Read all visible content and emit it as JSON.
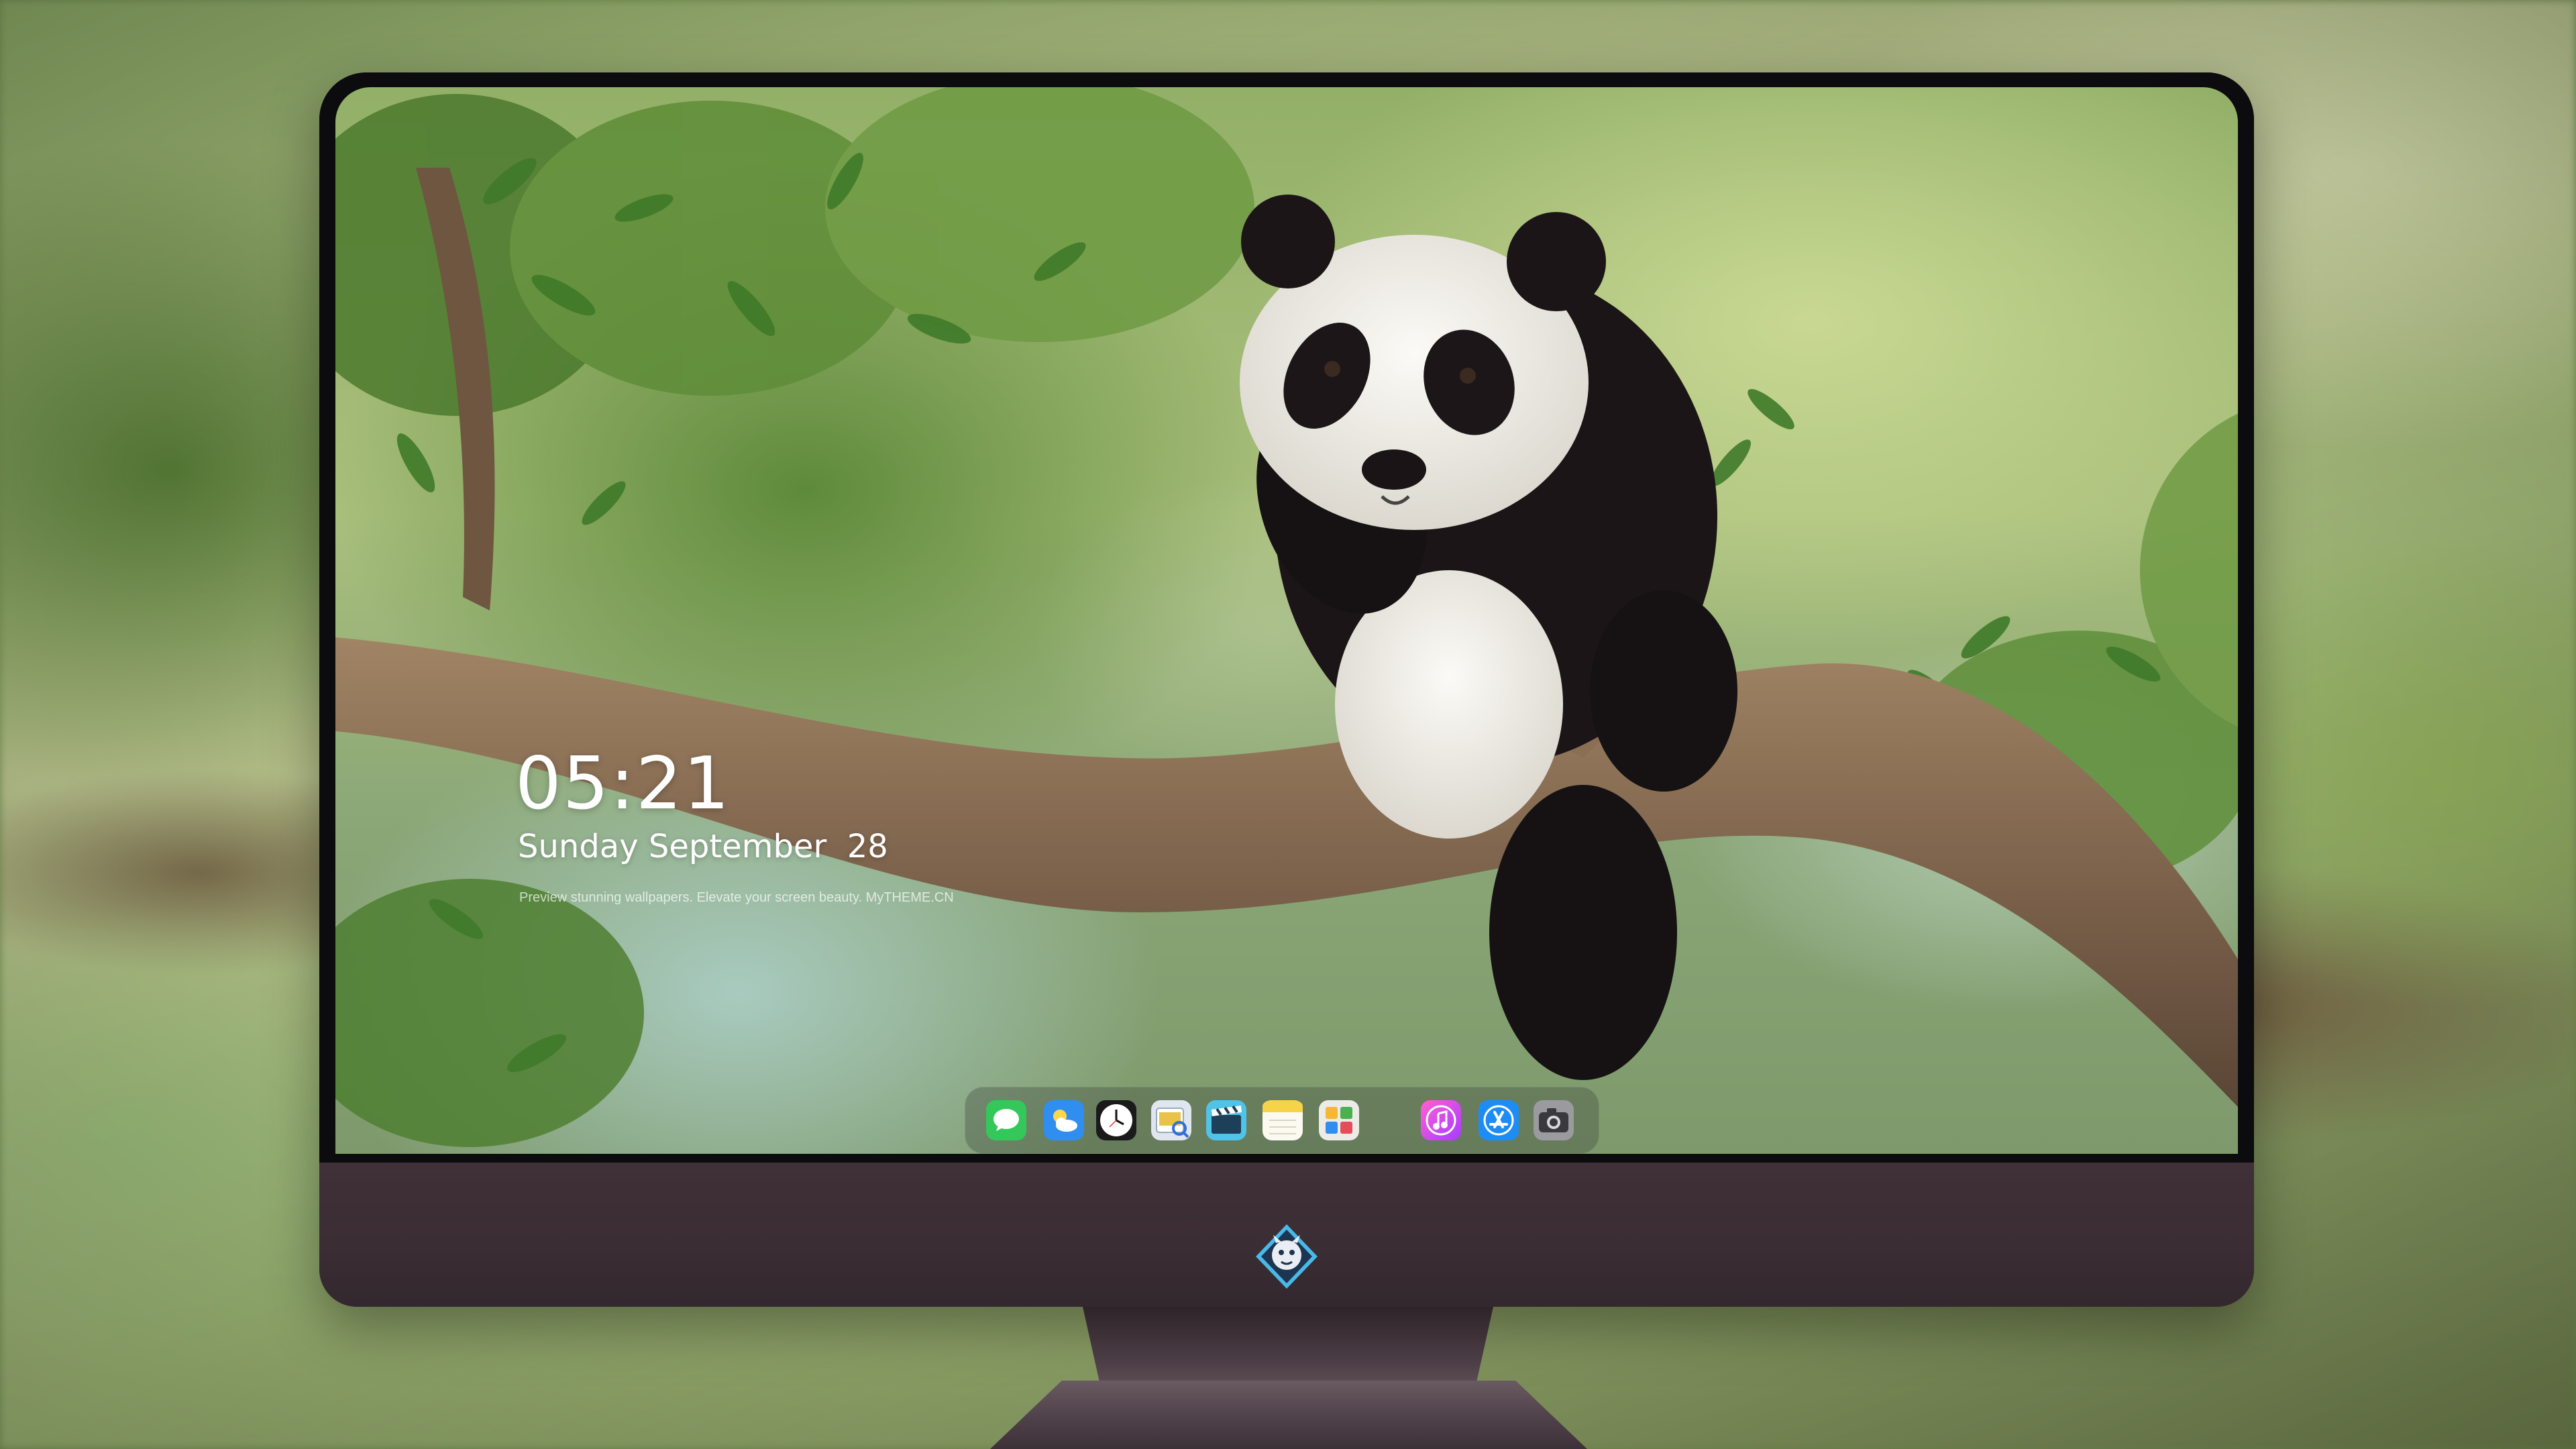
{
  "lock_screen": {
    "time": "05:21",
    "date": "Sunday September  28",
    "tagline": "Preview stunning wallpapers. Elevate your screen beauty. MyTHEME.CN"
  },
  "dock": {
    "apps": [
      {
        "name": "Messages",
        "icon": "messages-icon",
        "color": "#34c759"
      },
      {
        "name": "Weather",
        "icon": "weather-icon",
        "color": "#2f8ef0"
      },
      {
        "name": "Clock",
        "icon": "clock-icon",
        "color": "#1a1a1a"
      },
      {
        "name": "Preview",
        "icon": "preview-icon",
        "color": "#e9c24a"
      },
      {
        "name": "Clips",
        "icon": "clips-icon",
        "color": "#4fc3e8"
      },
      {
        "name": "Notes",
        "icon": "notes-icon",
        "color": "#f7d34a"
      },
      {
        "name": "Photos",
        "icon": "photos-icon",
        "color": "#e8e8e8"
      },
      {
        "name": "Music",
        "icon": "music-icon",
        "color": "#e845c9"
      },
      {
        "name": "App Store",
        "icon": "app-store-icon",
        "color": "#1e8cf5"
      },
      {
        "name": "Camera",
        "icon": "camera-icon",
        "color": "#8e8e93"
      }
    ]
  },
  "colors": {
    "chin": "#3a2d33",
    "bezel": "#0c0c0e",
    "accent": "#ffffff"
  }
}
